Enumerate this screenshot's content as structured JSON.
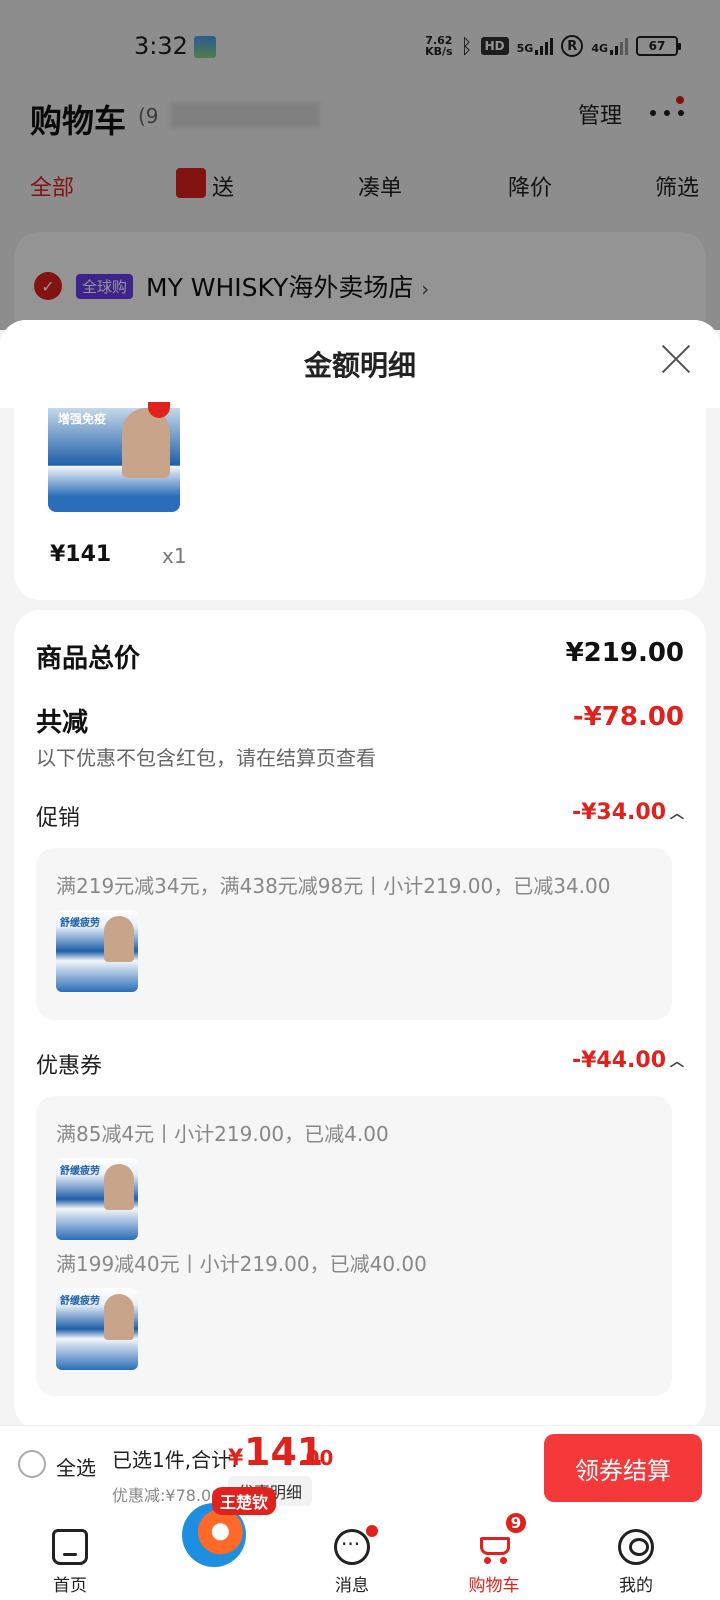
{
  "status_bar": {
    "time": "3:32",
    "net_speed_value": "7.62",
    "net_speed_unit": "KB/s",
    "hd": "HD",
    "signal1_label": "5G",
    "signal2_label": "4G",
    "r_label": "R",
    "battery": "67"
  },
  "cart_header": {
    "title": "购物车",
    "count": "(9",
    "manage": "管理",
    "tabs": [
      "全部",
      "送",
      "凑单",
      "降价",
      "筛选"
    ],
    "store": {
      "badge": "全球购",
      "name": "MY WHISKY海外卖场店",
      "chevron": "›"
    }
  },
  "sheet": {
    "title": "金额明细",
    "product": {
      "price": "¥141",
      "qty": "x1",
      "thumb_text": "增强免疫"
    },
    "goods_total_label": "商品总价",
    "goods_total_value": "¥219.00",
    "reduction_label": "共减",
    "reduction_value": "-¥78.00",
    "note": "以下优惠不包含红包，请在结算页查看",
    "promo": {
      "label": "促销",
      "value": "-¥34.00",
      "rule": "满219元减34元，满438元减98元丨小计219.00，已减34.00",
      "thumb_text": "舒缓疲劳"
    },
    "coupon": {
      "label": "优惠券",
      "value": "-¥44.00",
      "rule1": "满85减4元丨小计219.00，已减4.00",
      "rule2": "满199减40元丨小计219.00，已减40.00",
      "thumb_text": "舒缓疲劳"
    }
  },
  "checkout": {
    "select_all": "全选",
    "selected": "已选1件,合计:",
    "currency": "¥",
    "total_int": "141",
    "total_dec": ".00",
    "discount": "优惠减:¥78.00",
    "discount_detail": "优惠明细",
    "button": "领券结算"
  },
  "nav": {
    "home": "首页",
    "promo_tag": "王楚钦",
    "messages": "消息",
    "cart": "购物车",
    "cart_badge": "9",
    "me": "我的"
  }
}
